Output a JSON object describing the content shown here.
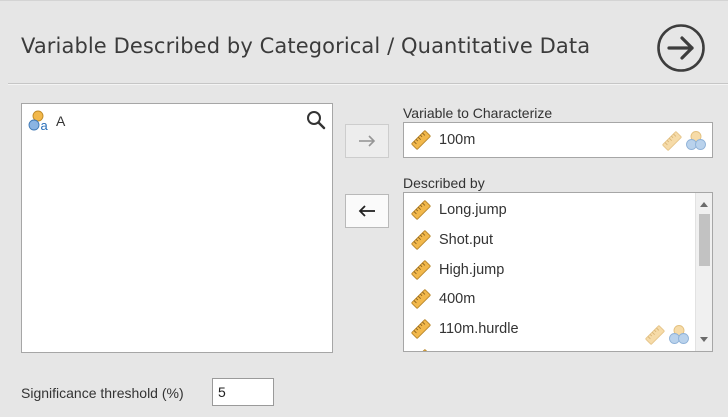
{
  "header": {
    "title": "Variable Described by Categorical / Quantitative Data",
    "run_icon": "circle-arrow-right-icon"
  },
  "source_list": {
    "search_icon": "search-icon",
    "items": [
      {
        "label": "A",
        "icon": "nominal-text-variable-icon"
      }
    ]
  },
  "buttons": {
    "move_right_icon": "arrow-right-icon",
    "move_left_icon": "arrow-left-icon"
  },
  "variable_to_characterize": {
    "label": "Variable to Characterize",
    "value": "100m",
    "icon": "ruler-continuous-icon"
  },
  "described_by": {
    "label": "Described by",
    "items": [
      {
        "label": "Long.jump"
      },
      {
        "label": "Shot.put"
      },
      {
        "label": "High.jump"
      },
      {
        "label": "400m"
      },
      {
        "label": "110m.hurdle"
      }
    ]
  },
  "significance": {
    "label": "Significance threshold (%)",
    "value": "5"
  },
  "colors": {
    "ruler": "#f2b84b",
    "ruler_faded": "#f6dba8",
    "nominal_a": "#2a6fb8",
    "nominal_b": "#e6a93a"
  }
}
